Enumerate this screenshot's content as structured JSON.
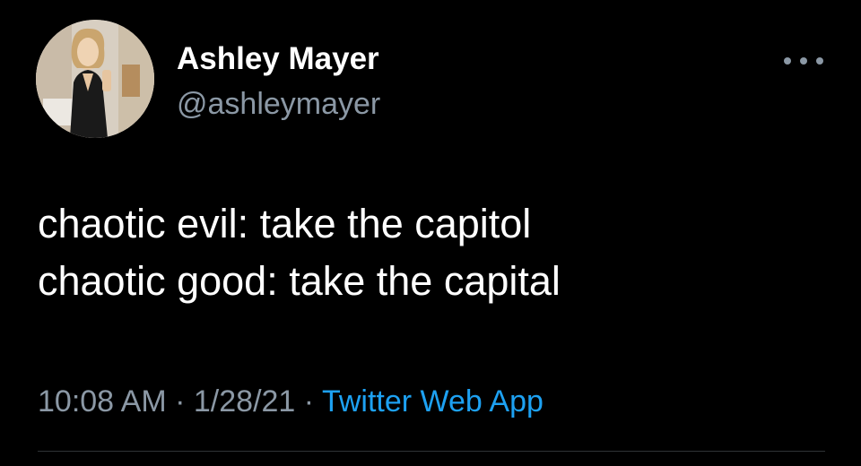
{
  "tweet": {
    "author": {
      "display_name": "Ashley Mayer",
      "handle": "@ashleymayer",
      "avatar_icon": "profile-photo"
    },
    "more_icon": "more-horizontal-icon",
    "text_lines": [
      "chaotic evil: take the capitol",
      "chaotic good: take the capital"
    ],
    "meta": {
      "time": "10:08 AM",
      "separator": "·",
      "date": "1/28/21",
      "source": "Twitter Web App"
    }
  },
  "colors": {
    "background": "#000000",
    "primary_text": "#ffffff",
    "secondary_text": "#8b98a5",
    "link": "#1da1f2"
  }
}
